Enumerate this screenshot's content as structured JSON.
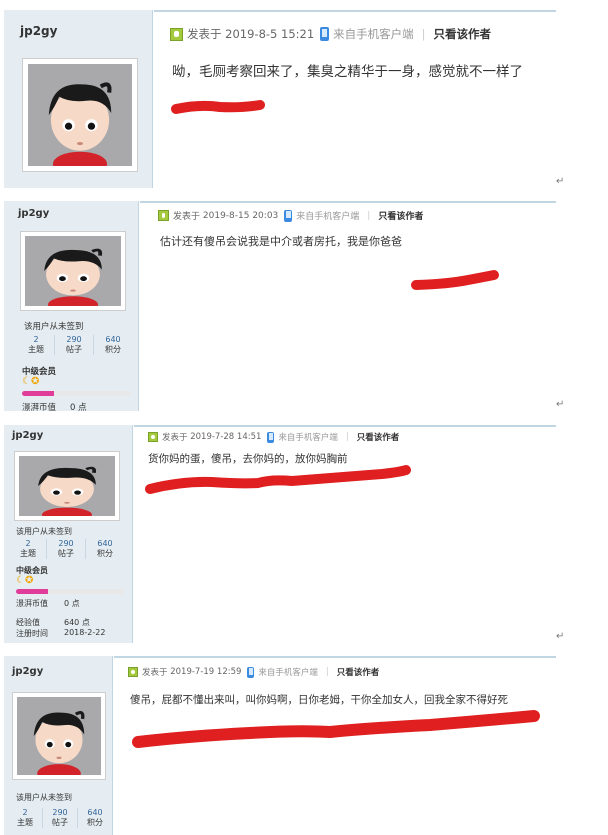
{
  "posts": [
    {
      "username": "jp2gy",
      "meta": {
        "prefix": "发表于",
        "datetime": "2019-8-5 15:21",
        "mobile": "来自手机客户端",
        "only_author": "只看该作者"
      },
      "content": "呦，毛厕考察回来了，集臭之精华于一身，感觉就不一样了"
    },
    {
      "username": "jp2gy",
      "meta": {
        "prefix": "发表于",
        "datetime": "2019-8-15 20:03",
        "mobile": "来自手机客户端",
        "only_author": "只看该作者"
      },
      "content": "估计还有傻吊会说我是中介或者房托，我是你爸爸",
      "profile": {
        "signin": "该用户从未签到",
        "stats": [
          {
            "value": "2",
            "label": "主题"
          },
          {
            "value": "290",
            "label": "帖子"
          },
          {
            "value": "640",
            "label": "积分"
          }
        ],
        "rank": "中级会员",
        "rank_progress": 0.3,
        "coin_label": "澋湃币值",
        "coin_value": "0 点"
      }
    },
    {
      "username": "jp2gy",
      "meta": {
        "prefix": "发表于",
        "datetime": "2019-7-28 14:51",
        "mobile": "来自手机客户端",
        "only_author": "只看该作者"
      },
      "content": "货你妈的蛋，傻吊，去你妈的，放你妈胸前",
      "profile": {
        "signin": "该用户从未签到",
        "stats": [
          {
            "value": "2",
            "label": "主题"
          },
          {
            "value": "290",
            "label": "帖子"
          },
          {
            "value": "640",
            "label": "积分"
          }
        ],
        "rank": "中级会员",
        "rank_progress": 0.3,
        "coin_label": "澋湃币值",
        "coin_value": "0 点",
        "exp_label": "经验值",
        "exp_value": "640 点",
        "reg_label": "注册时间",
        "reg_value": "2018-2-22"
      }
    },
    {
      "username": "jp2gy",
      "meta": {
        "prefix": "发表于",
        "datetime": "2019-7-19 12:59",
        "mobile": "来自手机客户端",
        "only_author": "只看该作者"
      },
      "content": "傻吊，屁都不懂出来叫，叫你妈啊，日你老姆，干你全加女人，回我全家不得好死",
      "profile": {
        "signin": "该用户从未签到",
        "stats": [
          {
            "value": "2",
            "label": "主题"
          },
          {
            "value": "290",
            "label": "帖子"
          },
          {
            "value": "640",
            "label": "积分"
          }
        ]
      }
    }
  ],
  "icons": {
    "online": "online-status-icon",
    "phone": "mobile-phone-icon",
    "return": "paragraph-return-mark",
    "stars": "moon-star-rank-icon"
  },
  "colors": {
    "sidebar": "#e5edf2",
    "border": "#c2d5e3",
    "redaction": "#e02020",
    "rank_bar": "#e03c9a",
    "online": "#a5c93c",
    "phone": "#3a8be0"
  },
  "return_mark": "↵"
}
